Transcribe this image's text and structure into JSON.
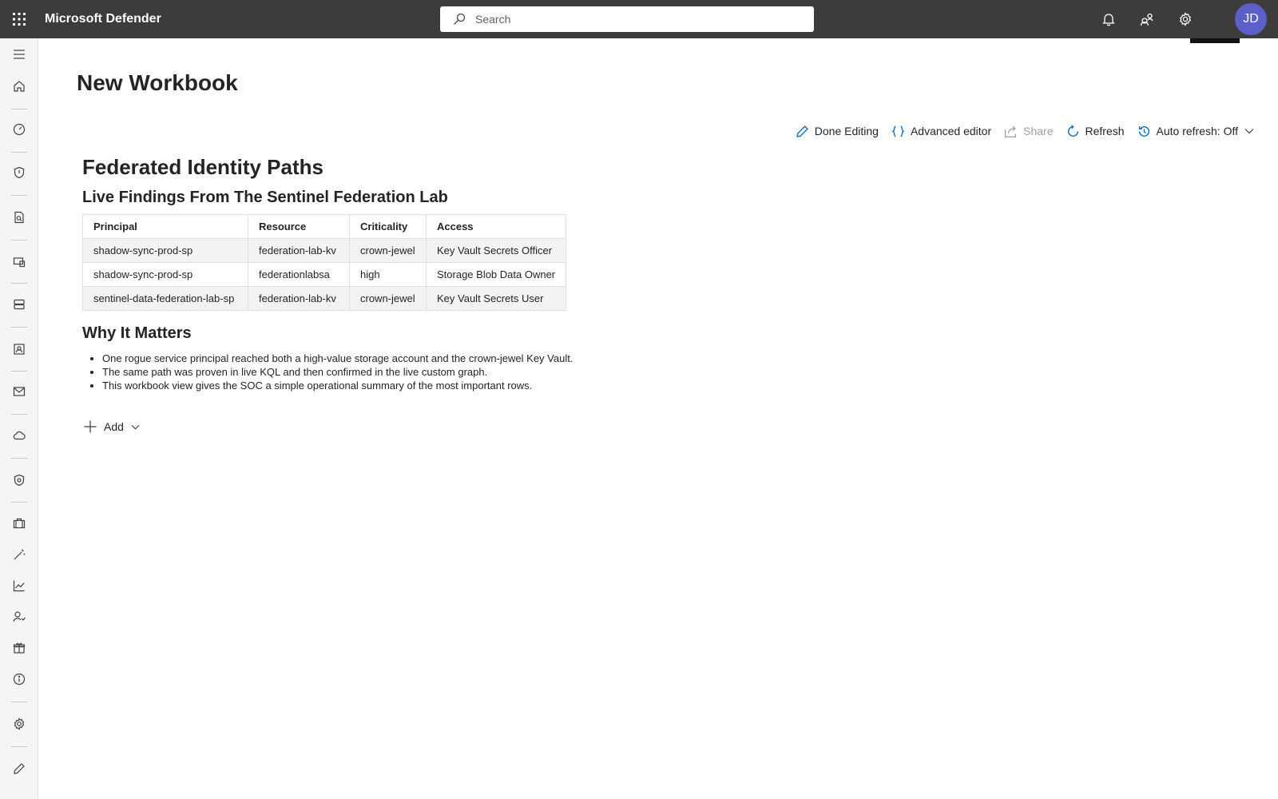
{
  "app": {
    "title": "Microsoft Defender"
  },
  "search": {
    "placeholder": "Search"
  },
  "user": {
    "initials": "JD",
    "avatar_color": "#5b5fc7"
  },
  "page": {
    "title": "New Workbook"
  },
  "toolbar": {
    "done_editing": "Done Editing",
    "advanced_editor": "Advanced editor",
    "share": "Share",
    "refresh": "Refresh",
    "auto_refresh": "Auto refresh: Off"
  },
  "workbook": {
    "title": "Federated Identity Paths",
    "subtitle": "Live Findings From The Sentinel Federation Lab",
    "table": {
      "headers": [
        "Principal",
        "Resource",
        "Criticality",
        "Access"
      ],
      "rows": [
        [
          "shadow-sync-prod-sp",
          "federation-lab-kv",
          "crown-jewel",
          "Key Vault Secrets Officer"
        ],
        [
          "shadow-sync-prod-sp",
          "federationlabsa",
          "high",
          "Storage Blob Data Owner"
        ],
        [
          "sentinel-data-federation-lab-sp",
          "federation-lab-kv",
          "crown-jewel",
          "Key Vault Secrets User"
        ]
      ]
    },
    "why_title": "Why It Matters",
    "why_points": [
      "One rogue service principal reached both a high-value storage account and the crown-jewel Key Vault.",
      "The same path was proven in live KQL and then confirmed in the live custom graph.",
      "This workbook view gives the SOC a simple operational summary of the most important rows."
    ],
    "add_label": "Add"
  },
  "colors": {
    "topbar": "#3c3c3c",
    "accent": "#0f6cbd"
  }
}
